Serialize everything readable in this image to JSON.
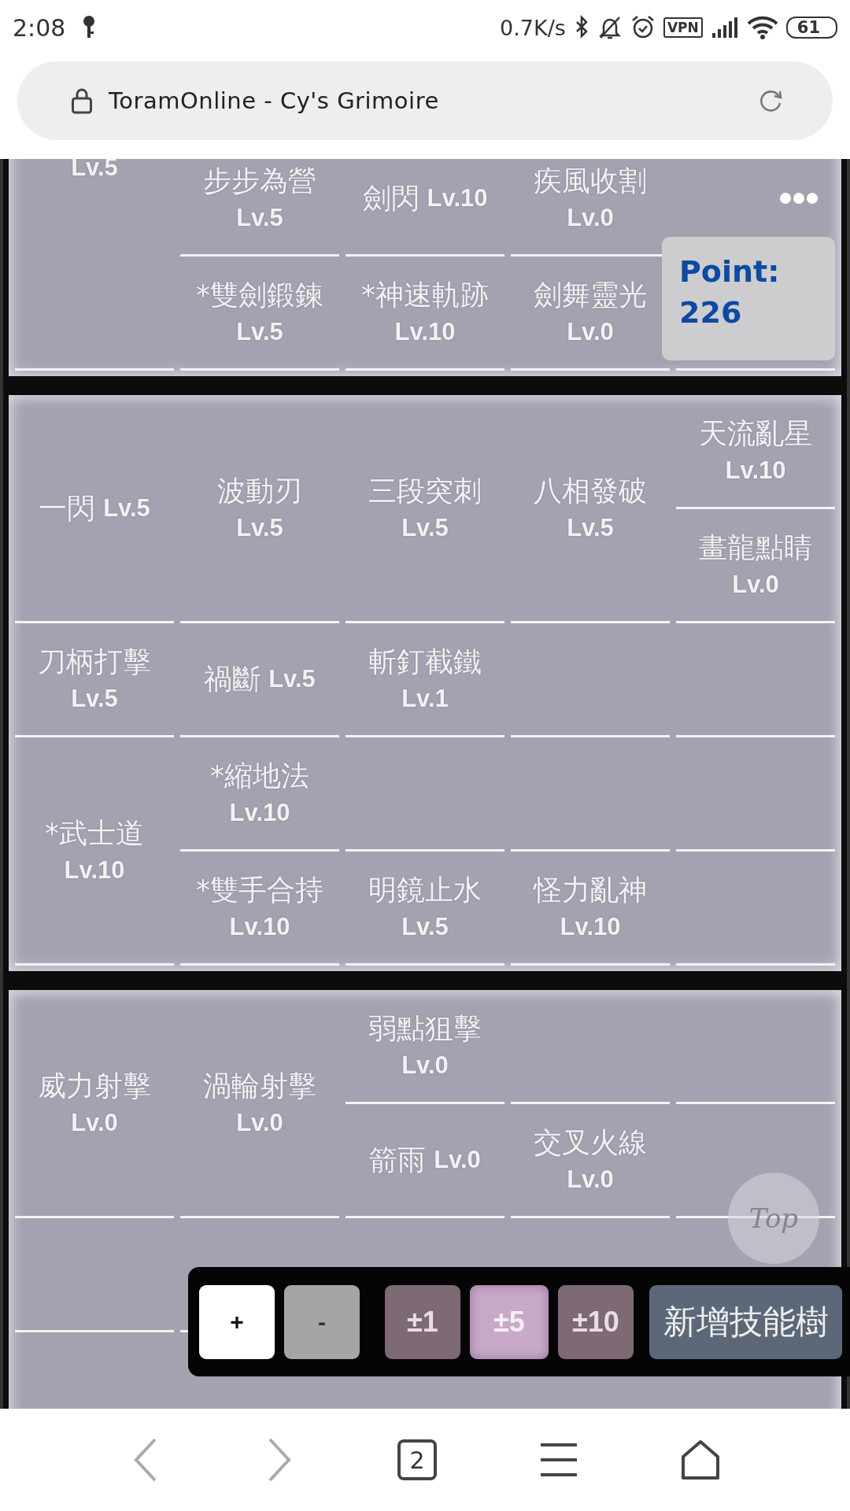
{
  "status_bar": {
    "time": "2:08",
    "speed": "0.7K/s",
    "vpn": "VPN",
    "battery": "61"
  },
  "address_bar": {
    "title": "ToramOnline - Cy's Grimoire"
  },
  "skill_trees": [
    {
      "roots": [
        {
          "level": "Lv.5",
          "children": [
            {
              "name": "步步為營",
              "level": "Lv.5",
              "children": [
                {
                  "name": "劍閃",
                  "level": "Lv.10",
                  "inline": true,
                  "children": [
                    {
                      "name": "疾風收割",
                      "level": "Lv.0"
                    }
                  ]
                }
              ]
            },
            {
              "name": "*雙劍鍛鍊",
              "level": "Lv.5",
              "children": [
                {
                  "name": "*神速軌跡",
                  "level": "Lv.10",
                  "children": [
                    {
                      "name": "劍舞靈光",
                      "level": "Lv.0"
                    }
                  ]
                }
              ]
            }
          ]
        }
      ]
    },
    {
      "roots": [
        {
          "name": "一閃",
          "level": "Lv.5",
          "inline": true,
          "children": [
            {
              "name": "波動刃",
              "level": "Lv.5",
              "children": [
                {
                  "name": "三段突刺",
                  "level": "Lv.5",
                  "children": [
                    {
                      "name": "八相發破",
                      "level": "Lv.5",
                      "children": [
                        {
                          "name": "天流亂星",
                          "level": "Lv.10"
                        },
                        {
                          "name": "畫龍點睛",
                          "level": "Lv.0"
                        }
                      ]
                    }
                  ]
                }
              ]
            }
          ]
        },
        {
          "name": "刀柄打擊",
          "level": "Lv.5",
          "children": [
            {
              "name": "禍斷",
              "level": "Lv.5",
              "inline": true,
              "children": [
                {
                  "name": "斬釘截鐵",
                  "level": "Lv.1"
                }
              ]
            }
          ]
        },
        {
          "name": "*武士道",
          "level": "Lv.10",
          "children": [
            {
              "name": "*縮地法",
              "level": "Lv.10"
            },
            {
              "name": "*雙手合持",
              "level": "Lv.10",
              "children": [
                {
                  "name": "明鏡止水",
                  "level": "Lv.5",
                  "children": [
                    {
                      "name": "怪力亂神",
                      "level": "Lv.10"
                    }
                  ]
                }
              ]
            }
          ]
        }
      ]
    },
    {
      "roots": [
        {
          "name": "威力射擊",
          "level": "Lv.0",
          "children": [
            {
              "name": "渦輪射擊",
              "level": "Lv.0",
              "children": [
                {
                  "name": "弱點狙擊",
                  "level": "Lv.0"
                },
                {
                  "name": "箭雨",
                  "level": "Lv.0",
                  "inline": true,
                  "children": [
                    {
                      "name": "交叉火線",
                      "level": "Lv.0"
                    }
                  ]
                }
              ]
            }
          ]
        }
      ]
    }
  ],
  "points_panel": {
    "label": "Point:",
    "value": "226"
  },
  "top_button": {
    "label": "Top"
  },
  "toolbar": {
    "modes": [
      {
        "label": "+",
        "selected": true
      },
      {
        "label": "-",
        "selected": false
      }
    ],
    "steps": [
      {
        "label": "±1",
        "selected": false
      },
      {
        "label": "±5",
        "selected": true
      },
      {
        "label": "±10",
        "selected": false
      }
    ],
    "new_tree": "新增技能樹"
  },
  "nav_bar": {
    "tab_count": "2"
  }
}
